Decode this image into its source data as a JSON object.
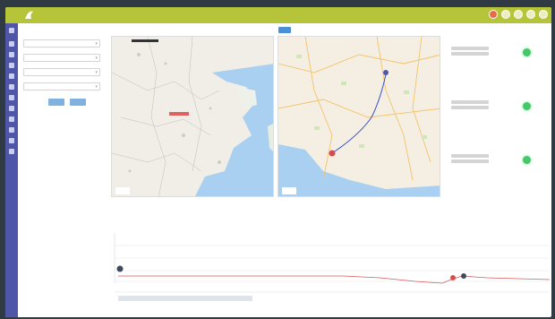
{
  "app": {
    "brand": "",
    "subtitle": "",
    "accent_color": "#b6c43a",
    "sidebar_color": "#4f56a8",
    "top_icons": [
      "globe-icon",
      "user-icon",
      "bell-icon",
      "download-icon",
      "settings-icon"
    ],
    "sidebar_icons": [
      "settings-icon",
      "home-icon",
      "map-icon",
      "list-icon",
      "chart-icon",
      "route-icon",
      "calendar-icon",
      "report-icon",
      "archive-icon",
      "tool-icon",
      "info-icon",
      "user-icon"
    ]
  },
  "watermark": {
    "text": ""
  },
  "filter": {
    "title": "",
    "fields": [
      {
        "value": ""
      },
      {
        "value": ""
      },
      {
        "value": ""
      },
      {
        "value": ""
      }
    ],
    "query_label": "",
    "reset_label": ""
  },
  "maps": {
    "left_title": "",
    "right_title": "",
    "right_tab": "",
    "left_location_label": "",
    "left_scale": "",
    "right_scale": ""
  },
  "nodes": {
    "title": "",
    "items": [
      {
        "name": "",
        "status": "online"
      },
      {
        "name": "",
        "status": "online"
      },
      {
        "name": "",
        "status": "online"
      }
    ]
  },
  "timeline": {
    "title": "",
    "center_label": "",
    "controls_label": ""
  },
  "footer": {
    "text": ""
  }
}
